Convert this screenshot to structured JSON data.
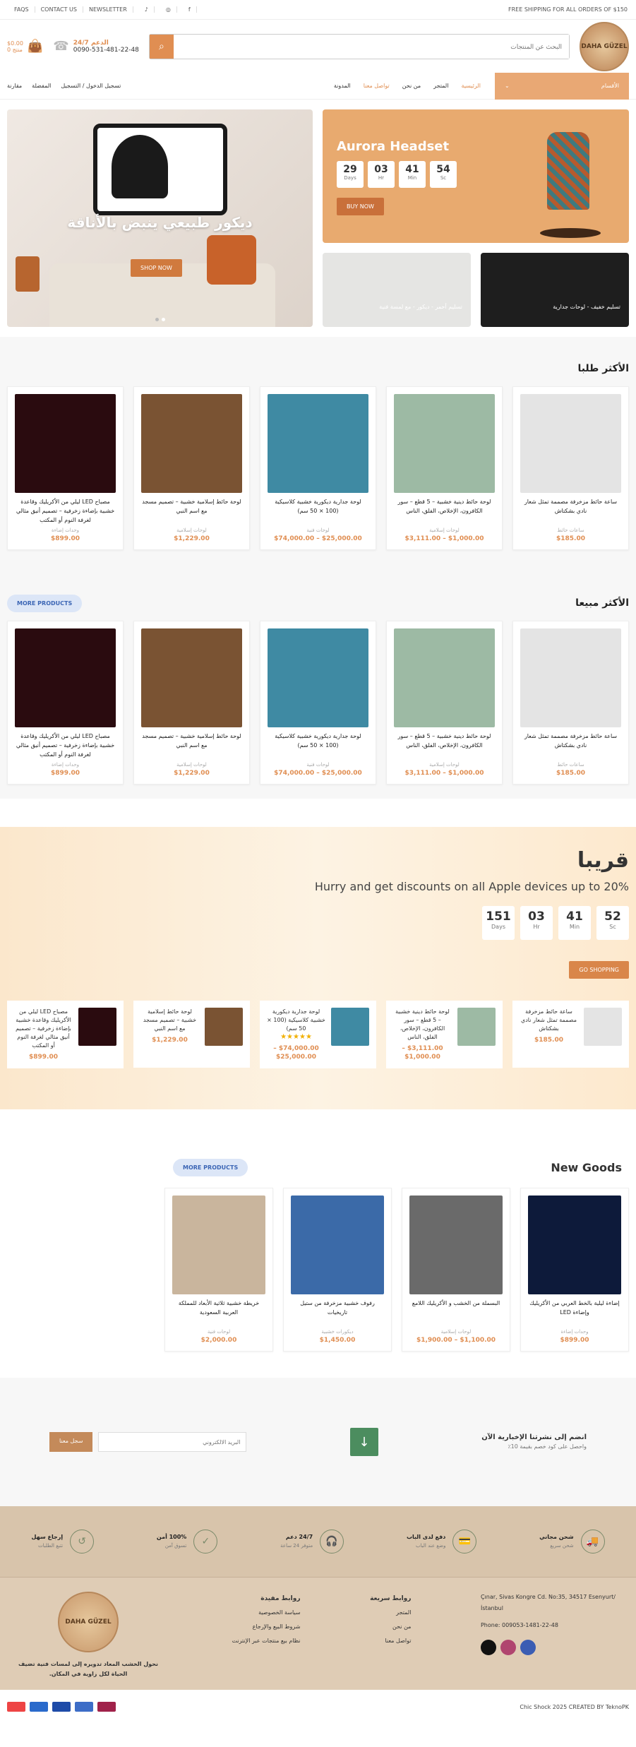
{
  "topbar": {
    "links": [
      "FAQS",
      "CONTACT US",
      "NEWSLETTER"
    ],
    "shipping": "FREE SHIPPING FOR ALL ORDERS OF $150"
  },
  "header": {
    "logo_text": "DAHA GÜZEL",
    "search_placeholder": "البحث عن المنتجات",
    "phone_label": "24/7 الدعم",
    "phone": "0090-531-481-22-48",
    "cart_total": "$0.00",
    "cart_label": "0 منتج"
  },
  "nav": {
    "categories": "الأقسام",
    "menu": [
      "الرئيسية",
      "المتجر",
      "من نحن",
      "تواصل معنا",
      "المدونة"
    ],
    "login": "تسجيل الدخول / التسجيل",
    "wishlist": "المفضلة",
    "compare": "مقارنة"
  },
  "hero": {
    "main_title": "ديكور طبيعي ينبض بالأناقة",
    "main_button": "SHOP NOW",
    "promo_title": "Aurora Headset",
    "countdown": [
      {
        "value": "29",
        "unit": "Days"
      },
      {
        "value": "03",
        "unit": "Hr"
      },
      {
        "value": "41",
        "unit": "Min"
      },
      {
        "value": "54",
        "unit": "Sc"
      }
    ],
    "promo_button": "BUY NOW",
    "tile1": "تسليم خفيف - لوحات جدارية",
    "tile2": "تسليم أحمر - ديكور - مع لمسة فنية"
  },
  "best_sellers": {
    "title": "الأكثر طلبا",
    "products": [
      {
        "name": "ساعة حائط مزخرفة مصممة تمثل شعار نادي بشكتاش",
        "cat": "ساعات حائط",
        "price": "$185.00",
        "color": "#e4e4e4"
      },
      {
        "name": "لوحة حائط دينية خشبية – 5 قطع – سور الكافرون، الإخلاص، الفلق، الناس",
        "cat": "لوحات إسلامية",
        "price": "$3,111.00 – $1,000.00",
        "color": "#9dbaa4"
      },
      {
        "name": "لوحة جدارية ديكورية خشبية كلاسيكية (100 × 50 سم)",
        "cat": "لوحات فنية",
        "price": "$74,000.00 – $25,000.00",
        "color": "#3f8aa3"
      },
      {
        "name": "لوحة حائط إسلامية خشبية – تصميم مسجد مع اسم النبي",
        "cat": "لوحات إسلامية",
        "price": "$1,229.00",
        "color": "#7a5333"
      },
      {
        "name": "مصباح LED ليلي من الأكريليك وقاعدة خشبية بإضاءة زخرفية – تصميم أنيق مثالي لغرفة النوم أو المكتب",
        "cat": "وحدات إضاءة",
        "price": "$899.00",
        "color": "#2a0b0f"
      }
    ]
  },
  "top_sold": {
    "title": "الأكثر مبيعا",
    "more": "MORE PRODUCTS"
  },
  "deal": {
    "title": "قريبا",
    "subtitle": "Hurry and get discounts on all Apple devices up to 20%",
    "countdown": [
      {
        "value": "151",
        "unit": "Days"
      },
      {
        "value": "03",
        "unit": "Hr"
      },
      {
        "value": "41",
        "unit": "Min"
      },
      {
        "value": "52",
        "unit": "Sc"
      }
    ],
    "button": "GO SHOPPING",
    "items": [
      {
        "name": "ساعة حائط مزخرفة مصممة تمثل شعار نادي بشكتاش",
        "price": "$185.00",
        "color": "#e4e4e4"
      },
      {
        "name": "لوحة حائط دينية خشبية – 5 قطع – سور الكافرون، الإخلاص، الفلق، الناس",
        "price": "$3,111.00 – $1,000.00",
        "color": "#9dbaa4"
      },
      {
        "name": "لوحة جدارية ديكورية خشبية كلاسيكية (100 × 50 سم)",
        "price": "$74,000.00 – $25,000.00",
        "color": "#3f8aa3",
        "stars": "★★★★★"
      },
      {
        "name": "لوحة حائط إسلامية خشبية – تصميم مسجد مع اسم النبي",
        "price": "$1,229.00",
        "color": "#7a5333"
      },
      {
        "name": "مصباح LED ليلي من الأكريليك وقاعدة خشبية بإضاءة زخرفية – تصميم أنيق مثالي لغرفة النوم أو المكتب",
        "price": "$899.00",
        "color": "#2a0b0f"
      }
    ]
  },
  "new_goods": {
    "title": "New Goods",
    "more": "MORE PRODUCTS",
    "products": [
      {
        "name": "إضاءة ليلية بالخط العربي من الأكريليك وإضاءة LED",
        "cat": "وحدات إضاءة",
        "price": "$899.00",
        "color": "#0d1a3a"
      },
      {
        "name": "البسملة من الخشب و الأكريليك اللامع",
        "cat": "لوحات إسلامية",
        "price": "$1,900.00 – $1,100.00",
        "color": "#6a6a6a"
      },
      {
        "name": "رفوف خشبية مزخرفة من ستيل تاريخيات",
        "cat": "ديكورات خشبية",
        "price": "$1,450.00",
        "color": "#3b6aa8"
      },
      {
        "name": "خريطة خشبية ثلاثية الأبعاد للمملكة العربية السعودية",
        "cat": "لوحات فنية",
        "price": "$2,000.00",
        "color": "#c9b59d"
      }
    ]
  },
  "newsletter": {
    "title": "انضم إلى نشرتنا الإخبارية الآن",
    "subtitle": "واحصل على كود خصم بقيمة 10٪",
    "placeholder": "البريد الالكتروني",
    "button": "سجل معنا"
  },
  "features": [
    {
      "title": "شحن مجاني",
      "sub": "شحن سريع",
      "icon": "🚚"
    },
    {
      "title": "دفع لدى الباب",
      "sub": "وضع عند الباب",
      "icon": "💳"
    },
    {
      "title": "24/7 دعم",
      "sub": "متوفر 24 ساعة",
      "icon": "🎧"
    },
    {
      "title": "100% أمن",
      "sub": "تسوق آمن",
      "icon": "✓"
    },
    {
      "title": "إرجاع سهل",
      "sub": "تتبع الطلبات",
      "icon": "↺"
    }
  ],
  "footer": {
    "address": "Çınar, Sivas Kongre Cd. No:35, 34517 Esenyurt/İstanbul",
    "phone": "Phone: 009053-1481-22-48",
    "quick_title": "روابط سريعة",
    "quick": [
      "المتجر",
      "من نحن",
      "تواصل معنا"
    ],
    "useful_title": "روابط مفيدة",
    "useful": [
      "سياسة الخصوصية",
      "شروط البيع والإرجاع",
      "نظام بيع منتجات عبر الإنترنت"
    ],
    "tagline": "نحول الخشب المعاد تدويره إلى لمسات فنية تضيف الحياة لكل زاوية في المكان.",
    "copyright": "Chic Shock 2025 CREATED BY TeknoPK"
  }
}
